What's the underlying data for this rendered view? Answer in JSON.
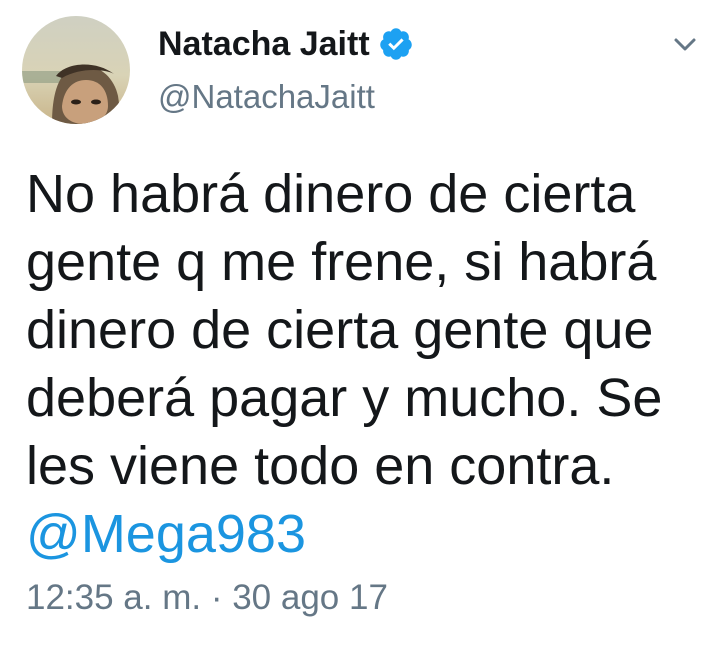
{
  "tweet": {
    "display_name": "Natacha Jaitt",
    "handle": "@NatachaJaitt",
    "verified": true,
    "text_lines": [
      "No habrá dinero de cierta",
      "gente q me frene, si habrá",
      "dinero de cierta gente que",
      "deberá pagar y mucho. Se",
      "les viene todo en contra."
    ],
    "mention": "@Mega983",
    "timestamp": "12:35 a. m. · 30 ago 17"
  },
  "icons": {
    "verified": "verified-badge-icon",
    "menu": "chevron-down-icon"
  },
  "colors": {
    "text": "#14171a",
    "secondary": "#657786",
    "link": "#1b95e0",
    "verified": "#1da1f2"
  }
}
